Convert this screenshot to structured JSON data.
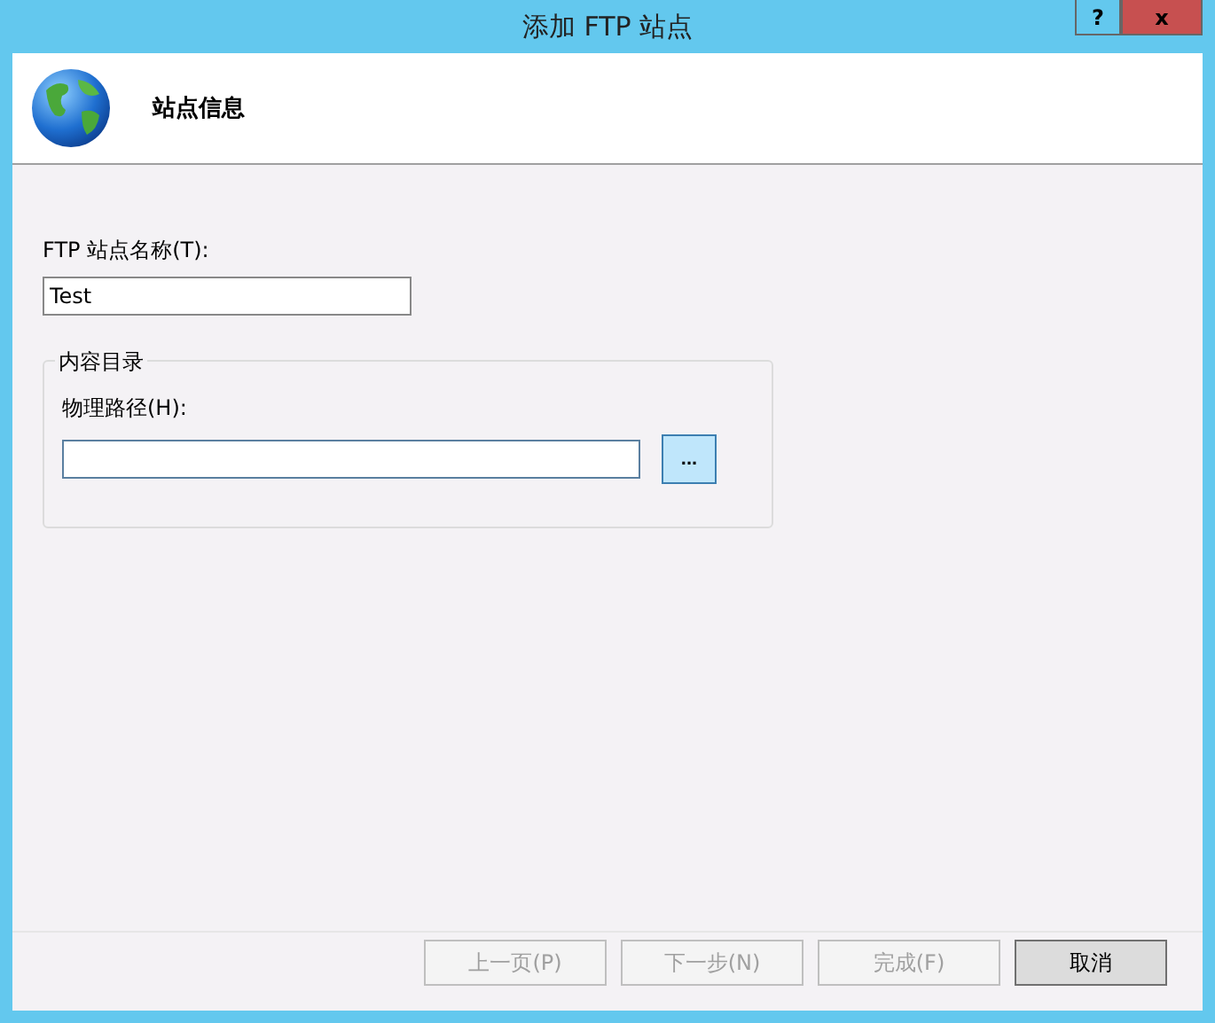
{
  "window": {
    "title": "添加 FTP 站点",
    "buttons": [
      {
        "label": "?",
        "kind": "help"
      },
      {
        "label": "x",
        "kind": "close"
      }
    ]
  },
  "header": {
    "title": "站点信息"
  },
  "site_name": {
    "label": "FTP 站点名称(T):",
    "value": "Test"
  },
  "content_directory": {
    "title": "内容目录",
    "path_label": "物理路径(H):",
    "browse": "..."
  },
  "buttons": [
    {
      "label": "上一页(P)",
      "disabled": true,
      "default": false
    },
    {
      "label": "下一步(N)",
      "disabled": true,
      "default": false
    },
    {
      "label": "完成(F)",
      "disabled": true,
      "default": false
    },
    {
      "label": "取消",
      "disabled": false,
      "default": true
    }
  ]
}
